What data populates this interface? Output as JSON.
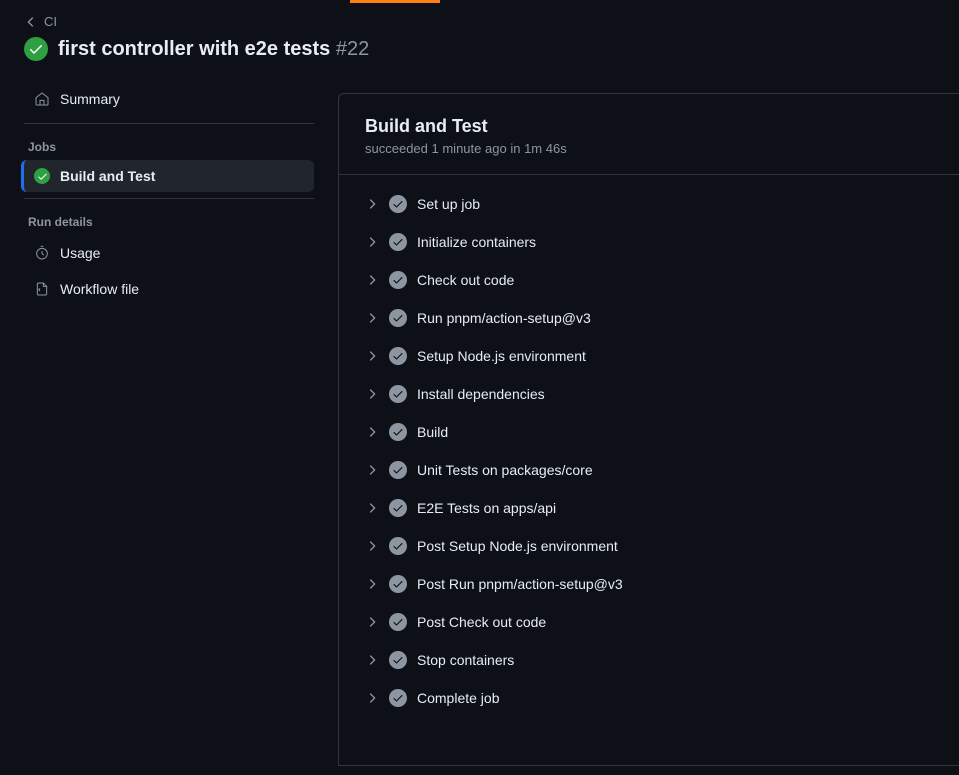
{
  "breadcrumb": {
    "label": "CI"
  },
  "workflow": {
    "title": "first controller with e2e tests",
    "run_number": "#22"
  },
  "sidebar": {
    "summary_label": "Summary",
    "jobs_label": "Jobs",
    "job_name": "Build and Test",
    "run_details_label": "Run details",
    "usage_label": "Usage",
    "workflow_file_label": "Workflow file"
  },
  "main": {
    "title": "Build and Test",
    "status": "succeeded",
    "when": "1 minute ago",
    "in_word": "in",
    "duration": "1m 46s"
  },
  "steps": [
    "Set up job",
    "Initialize containers",
    "Check out code",
    "Run pnpm/action-setup@v3",
    "Setup Node.js environment",
    "Install dependencies",
    "Build",
    "Unit Tests on packages/core",
    "E2E Tests on apps/api",
    "Post Setup Node.js environment",
    "Post Run pnpm/action-setup@v3",
    "Post Check out code",
    "Stop containers",
    "Complete job"
  ]
}
